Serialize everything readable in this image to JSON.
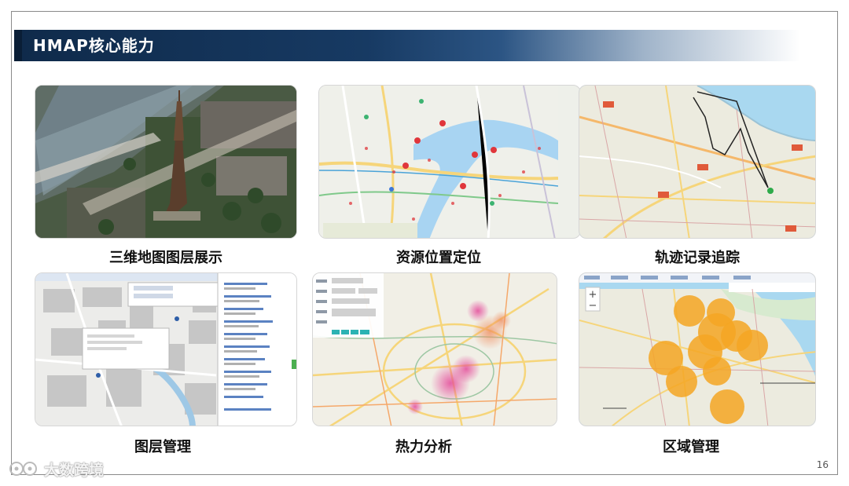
{
  "slide": {
    "title": "HMAP核心能力",
    "page_number": "16",
    "watermark": "大数跨境"
  },
  "features": [
    {
      "caption": "三维地图图层展示"
    },
    {
      "caption": "资源位置定位"
    },
    {
      "caption": "轨迹记录追踪"
    },
    {
      "caption": "图层管理"
    },
    {
      "caption": "热力分析"
    },
    {
      "caption": "区域管理"
    }
  ],
  "colors": {
    "title_bar": "#173a63",
    "marker_red": "#e0363b",
    "heat_pink": "#e86ab0",
    "region_orange": "#f5a623",
    "river_blue": "#a8d4f2",
    "road_yellow": "#f6d57a"
  },
  "icons": {
    "zoom_in": "plus-icon",
    "zoom_out": "minus-icon",
    "marker": "map-pin-icon",
    "watermark": "weibo-logo-icon"
  }
}
